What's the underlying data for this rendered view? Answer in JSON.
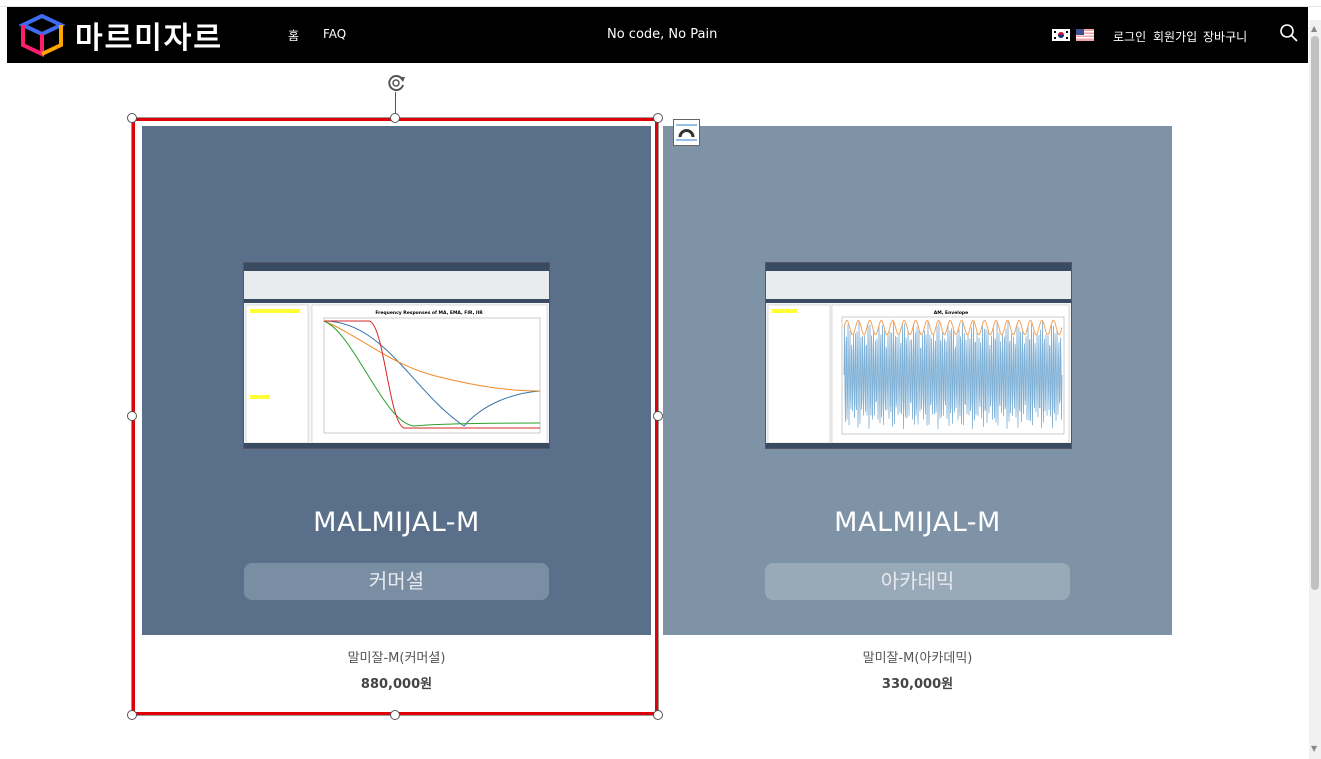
{
  "header": {
    "logo_text": "마르미자르",
    "nav": [
      "홈",
      "FAQ"
    ],
    "tagline": "No code, No Pain",
    "links": [
      "로그인",
      "회원가입",
      "장바구니"
    ],
    "flags": [
      "korea-flag",
      "usa-flag"
    ],
    "search_icon": "search-icon",
    "bg": "#000000"
  },
  "products": [
    {
      "title": "MALMIJAL-M",
      "badge": "커머셜",
      "name": "말미잘-M(커머셜)",
      "price": "880,000원",
      "bg": "#5a6f89",
      "badge_bg": "#7a8ea3",
      "chart_title": "Frequency Responses of MA, EMA, FIR, IIR"
    },
    {
      "title": "MALMIJAL-M",
      "badge": "아카데믹",
      "name": "말미잘-M(아카데믹)",
      "price": "330,000원",
      "bg": "#7f93a7",
      "badge_bg": "#98a9b8",
      "chart_title": "AM, Envelope"
    }
  ],
  "selection": {
    "selected_index": 0,
    "border_color": "#e0000a"
  }
}
